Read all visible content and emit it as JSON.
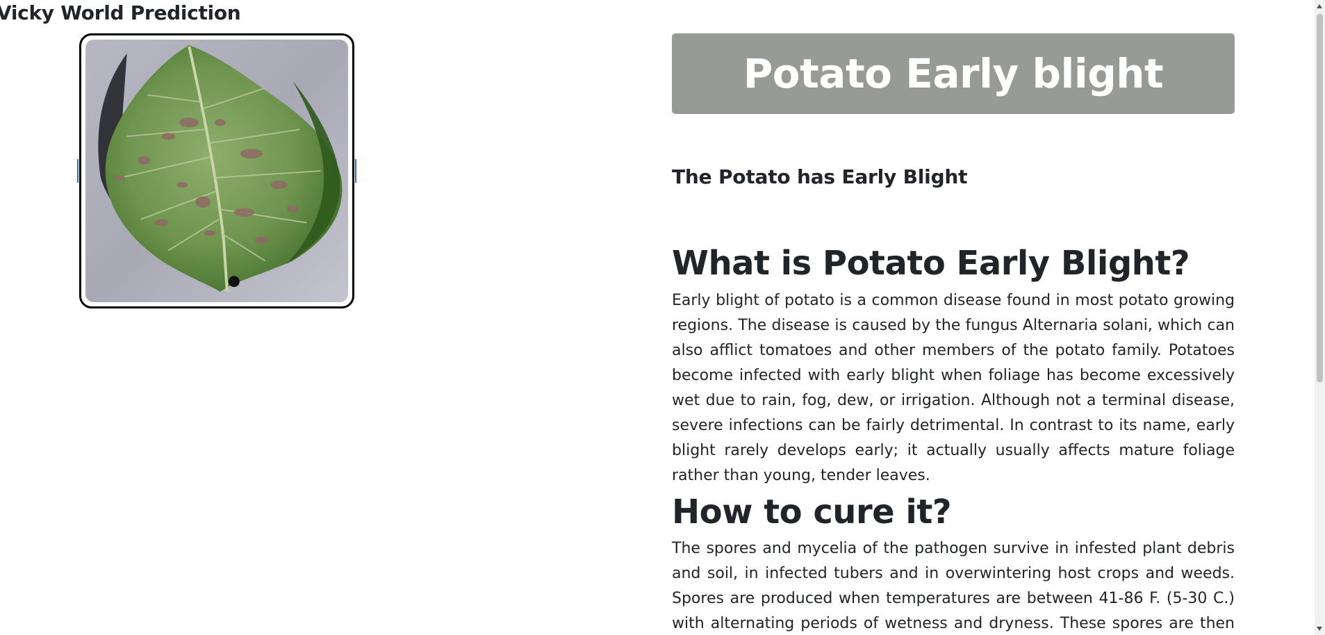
{
  "header": {
    "brand": "Vicky World Prediction"
  },
  "prediction": {
    "label": "Potato Early blight",
    "verdict": "The Potato has Early Blight"
  },
  "sections": [
    {
      "heading": "What is Potato Early Blight?",
      "body": "Early blight of potato is a common disease found in most potato growing regions. The disease is caused by the fungus Alternaria solani, which can also afflict tomatoes and other members of the potato family. Potatoes become infected with early blight when foliage has become excessively wet due to rain, fog, dew, or irrigation. Although not a terminal disease, severe infections can be fairly detrimental. In contrast to its name, early blight rarely develops early; it actually usually affects mature foliage rather than young, tender leaves."
    },
    {
      "heading": "How to cure it?",
      "body": "The spores and mycelia of the pathogen survive in infested plant debris and soil, in infected tubers and in overwintering host crops and weeds. Spores are produced when temperatures are between 41-86 F. (5-30 C.) with alternating periods of wetness and dryness. These spores are then spread"
    }
  ],
  "image": {
    "icon": "potato-leaf-photo"
  }
}
